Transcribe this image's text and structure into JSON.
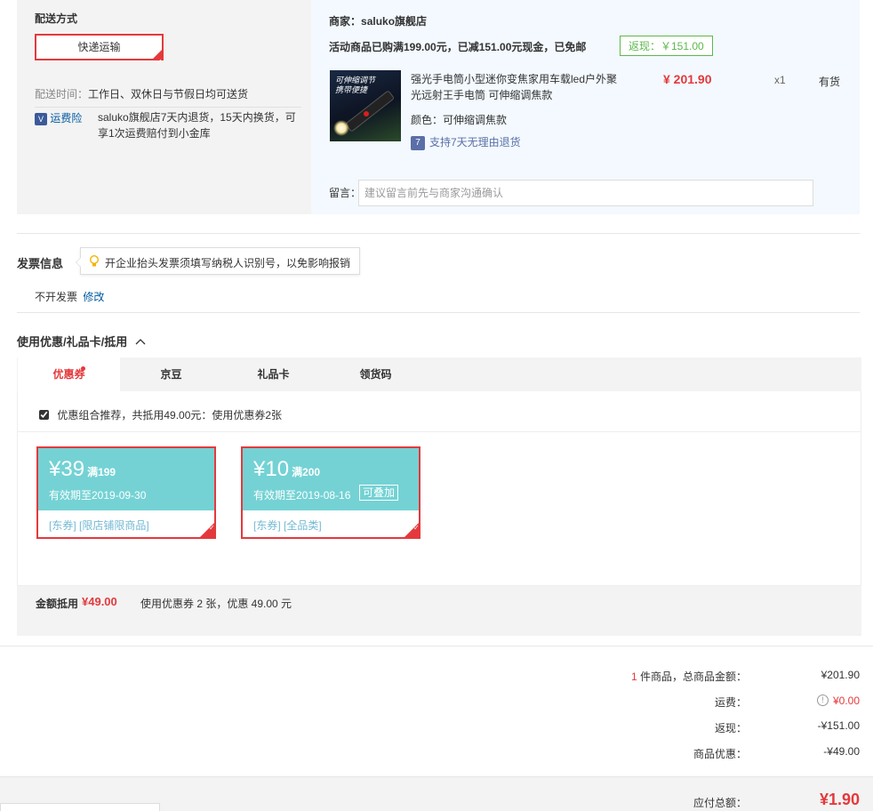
{
  "shipping": {
    "title": "配送方式",
    "method_button": "快递运输",
    "time_label": "配送时间：",
    "time_value": "工作日、双休日与节假日均可送货",
    "insurance_badge": "V",
    "insurance_link": "运费险",
    "insurance_desc_line1": "saluko旗舰店7天内退货，15天内换货，可",
    "insurance_desc_line2": "享1次运费赔付到小金库"
  },
  "store": {
    "merchant_label": "商家：",
    "merchant_name": "saluko旗舰店",
    "promo_text": "活动商品已购满199.00元，已减151.00元现金，已免邮",
    "rebate_tag": "返现：￥151.00",
    "product": {
      "image_caption_line1": "可伸缩调节",
      "image_caption_line2": "携带便捷",
      "name_line1": "强光手电筒小型迷你变焦家用车载led户外聚",
      "name_line2": "光远射王手电筒 可伸缩调焦款",
      "price": "¥ 201.90",
      "quantity": "x1",
      "stock": "有货",
      "color_label": "颜色：",
      "color_value": "可伸缩调焦款",
      "return_icon": "7",
      "return_text": "支持7天无理由退货"
    },
    "note_label": "留言：",
    "note_placeholder": "建议留言前先与商家沟通确认"
  },
  "invoice": {
    "title": "发票信息",
    "tip": "开企业抬头发票须填写纳税人识别号，以免影响报销",
    "status": "不开发票",
    "edit_link": "修改"
  },
  "coupons": {
    "section_title": "使用优惠/礼品卡/抵用",
    "collapse_icon": "chevron-up-icon",
    "tabs": [
      "优惠券",
      "京豆",
      "礼品卡",
      "领货码"
    ],
    "combo_recommend": "优惠组合推荐，共抵用49.00元：使用优惠券2张",
    "items": [
      {
        "symbol": "¥",
        "amount": "39",
        "condition": "满199",
        "expiry": "有效期至2019-09-30",
        "stackable": "",
        "tags": "[东券]   [限店铺限商品]"
      },
      {
        "symbol": "¥",
        "amount": "10",
        "condition": "满200",
        "expiry": "有效期至2019-08-16",
        "stackable": "可叠加",
        "tags": "[东券]   [全品类]"
      }
    ],
    "summary_label": "金额抵用",
    "summary_amount": "¥49.00",
    "summary_desc": "使用优惠券 2 张，优惠 49.00 元"
  },
  "totals": {
    "item_count": "1",
    "item_count_suffix": " 件商品，总商品金额：",
    "goods_total": "¥201.90",
    "shipping_label": "运费：",
    "shipping_info_icon": "!",
    "shipping_value": "¥0.00",
    "rebate_label": "返现：",
    "rebate_value": "-¥151.00",
    "discount_label": "商品优惠：",
    "discount_value": "-¥49.00",
    "payable_label": "应付总额：",
    "payable_value": "¥1.90"
  },
  "colors": {
    "accent_red": "#e4393c",
    "coupon_teal": "#74d2d4",
    "rebate_green": "#5db84c",
    "link_blue": "#005aa0"
  }
}
